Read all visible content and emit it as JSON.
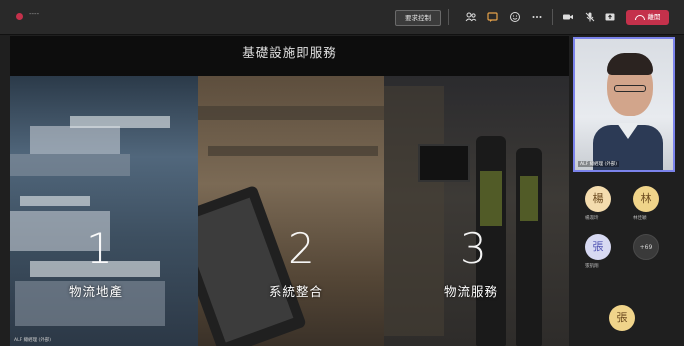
{
  "topbar": {
    "timer": "----",
    "request_control_label": "要求控制",
    "leave_label": "離開",
    "icons": [
      "people-icon",
      "chat-icon",
      "reaction-icon",
      "more-icon",
      "camera-icon",
      "mic-icon",
      "share-icon",
      "phone-icon"
    ]
  },
  "slide": {
    "title": "基礎設施即服務",
    "panels": [
      {
        "number": "1",
        "label": "物流地產"
      },
      {
        "number": "2",
        "label": "系統整合"
      },
      {
        "number": "3",
        "label": "物流服務"
      }
    ],
    "presenter_caption": "ALF 總經理 (外部)"
  },
  "participants": {
    "video_name": "ALF 總經理 (外部)",
    "avatars": [
      {
        "initial": "楊",
        "name": "楊淑玲"
      },
      {
        "initial": "林",
        "name": "林佳穎"
      },
      {
        "initial": "張",
        "name": "張凱翔"
      },
      {
        "initial": "+69",
        "name": ""
      },
      {
        "initial": "張",
        "name": ""
      }
    ]
  },
  "colors": {
    "accent": "#7b83eb",
    "leave": "#c4314b",
    "background": "#1f1f1f"
  }
}
